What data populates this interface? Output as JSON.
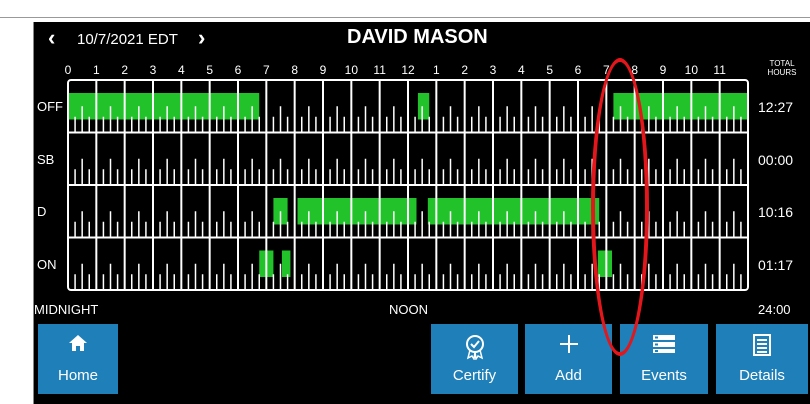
{
  "header": {
    "prev_icon": "chevron-left-icon",
    "date": "10/7/2021 EDT",
    "next_icon": "chevron-right-icon",
    "driver_name": "DAVID MASON"
  },
  "hour_labels": [
    "0",
    "1",
    "2",
    "3",
    "4",
    "5",
    "6",
    "7",
    "8",
    "9",
    "10",
    "11",
    "12",
    "1",
    "2",
    "3",
    "4",
    "5",
    "6",
    "7",
    "8",
    "9",
    "10",
    "11"
  ],
  "total_header": [
    "TOTAL",
    "HOURS"
  ],
  "rows": [
    {
      "label": "OFF",
      "total": "12:27"
    },
    {
      "label": "SB",
      "total": "00:00"
    },
    {
      "label": "D",
      "total": "10:16"
    },
    {
      "label": "ON",
      "total": "01:17"
    }
  ],
  "status_segments": [
    {
      "row": 0,
      "start_hour": 0.0,
      "end_hour": 6.75
    },
    {
      "row": 0,
      "start_hour": 12.35,
      "end_hour": 12.75
    },
    {
      "row": 0,
      "start_hour": 19.25,
      "end_hour": 24.0
    },
    {
      "row": 2,
      "start_hour": 7.25,
      "end_hour": 7.75
    },
    {
      "row": 2,
      "start_hour": 8.1,
      "end_hour": 12.3
    },
    {
      "row": 2,
      "start_hour": 12.7,
      "end_hour": 18.75
    },
    {
      "row": 3,
      "start_hour": 6.75,
      "end_hour": 7.25
    },
    {
      "row": 3,
      "start_hour": 7.55,
      "end_hour": 7.85
    },
    {
      "row": 3,
      "start_hour": 18.7,
      "end_hour": 19.2
    }
  ],
  "colors": {
    "status_bar": "#22c22a",
    "button": "#1f7fb8",
    "annotation": "#e3171b"
  },
  "footer": {
    "midnight": "MIDNIGHT",
    "noon": "NOON",
    "total": "24:00"
  },
  "buttons": [
    {
      "label": "Home",
      "icon": "home-icon"
    },
    {
      "label": "Certify",
      "icon": "certify-badge-icon"
    },
    {
      "label": "Add",
      "icon": "plus-icon"
    },
    {
      "label": "Events",
      "icon": "events-list-icon"
    },
    {
      "label": "Details",
      "icon": "details-document-icon"
    }
  ]
}
